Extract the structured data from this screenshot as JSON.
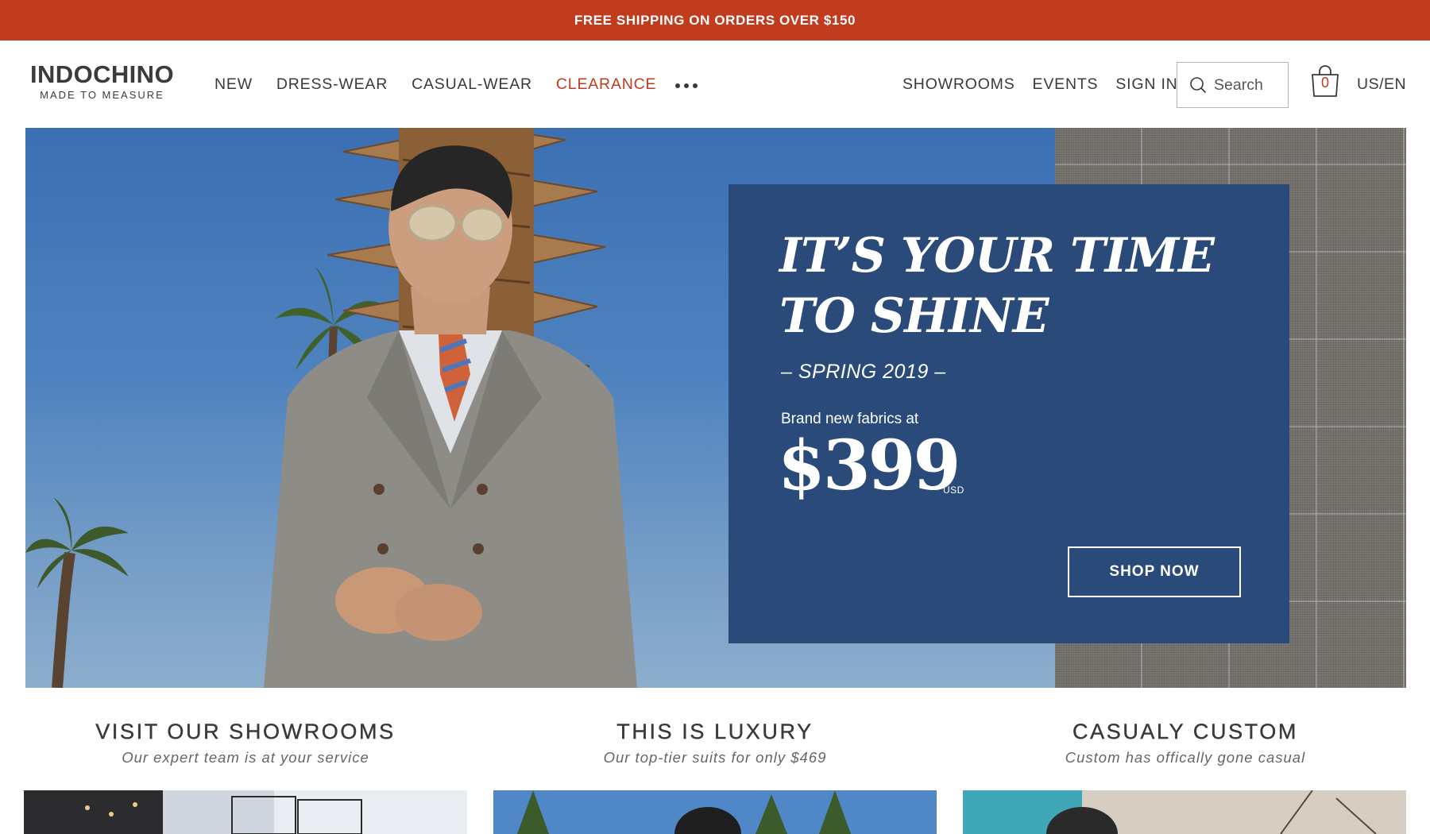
{
  "promo_bar": {
    "text": "FREE SHIPPING ON ORDERS OVER $150"
  },
  "brand": {
    "name": "INDOCHINO",
    "tagline": "MADE TO MEASURE"
  },
  "nav": {
    "items": [
      {
        "label": "NEW"
      },
      {
        "label": "DRESS-WEAR"
      },
      {
        "label": "CASUAL-WEAR"
      },
      {
        "label": "CLEARANCE",
        "highlight": "#c13b1e"
      }
    ],
    "more_icon": "ellipsis-icon",
    "secondary": [
      {
        "label": "SHOWROOMS"
      },
      {
        "label": "EVENTS"
      },
      {
        "label": "SIGN IN"
      }
    ]
  },
  "search": {
    "placeholder": "Search",
    "icon": "search-icon"
  },
  "cart": {
    "count": "0",
    "icon": "shopping-bag-icon"
  },
  "locale": "US/EN",
  "hero": {
    "headline_line1": "IT’S YOUR TIME",
    "headline_line2": "TO SHINE",
    "season": "– SPRING 2019 –",
    "subtitle": "Brand new fabrics at",
    "price": "$399",
    "currency": "USD",
    "cta": "SHOP NOW",
    "card_color": "#2a4a7a"
  },
  "features": [
    {
      "title": "VISIT OUR SHOWROOMS",
      "subtitle": "Our expert team is at your service"
    },
    {
      "title": "THIS IS LUXURY",
      "subtitle": "Our top-tier suits for only $469"
    },
    {
      "title": "CASUALY CUSTOM",
      "subtitle": "Custom has offically gone casual"
    }
  ],
  "colors": {
    "accent": "#c13b1e",
    "text": "#3a3a3a"
  }
}
